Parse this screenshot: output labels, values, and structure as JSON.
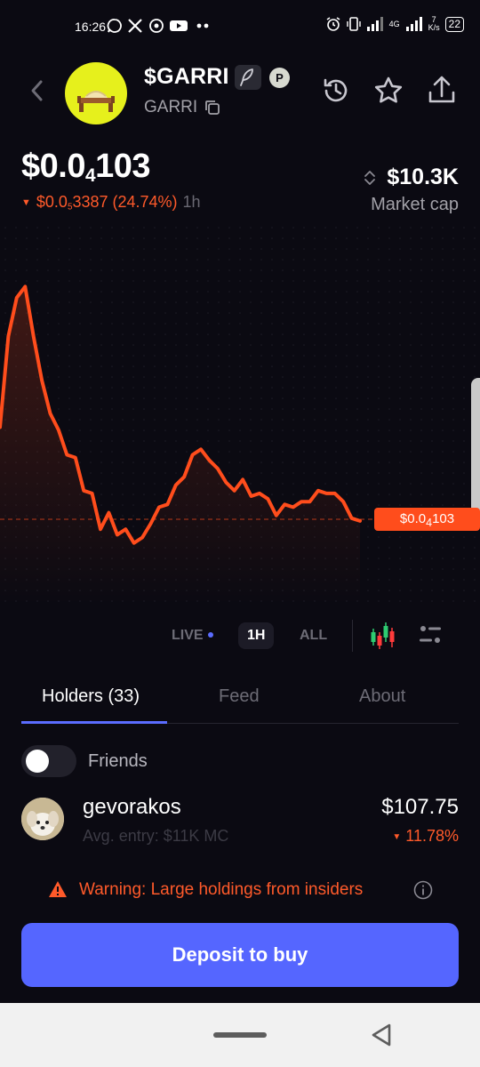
{
  "status_bar": {
    "time": "16:26",
    "network": "4G",
    "speed_top": "7",
    "speed_unit": "K/s",
    "battery": "22"
  },
  "token": {
    "name": "$GARRI",
    "ticker": "GARRI",
    "badge_letter": "P"
  },
  "price": {
    "prefix": "$0.0",
    "zeros_sub": "4",
    "digits": "103",
    "change_prefix": "$0.0",
    "change_sub": "5",
    "change_digits": "3387",
    "change_pct": "(24.74%)",
    "change_direction": "down",
    "timeframe": "1h"
  },
  "market_cap": {
    "value": "$10.3K",
    "label": "Market cap"
  },
  "chart_data": {
    "type": "line",
    "color": "#ff4d1c",
    "current_price_tag": {
      "prefix": "$0.0",
      "sub": "4",
      "digits": "103"
    },
    "y_relative": [
      0.45,
      0.78,
      0.92,
      0.96,
      0.78,
      0.62,
      0.5,
      0.44,
      0.35,
      0.34,
      0.22,
      0.21,
      0.08,
      0.14,
      0.06,
      0.08,
      0.03,
      0.05,
      0.1,
      0.16,
      0.17,
      0.24,
      0.27,
      0.35,
      0.37,
      0.33,
      0.3,
      0.25,
      0.22,
      0.26,
      0.2,
      0.21,
      0.19,
      0.13,
      0.17,
      0.16,
      0.18,
      0.18,
      0.22,
      0.21,
      0.21,
      0.18,
      0.12,
      0.11
    ]
  },
  "range_controls": {
    "live": "LIVE",
    "one_hour": "1H",
    "all": "ALL",
    "active": "1H"
  },
  "tabs": {
    "holders": "Holders (33)",
    "feed": "Feed",
    "about": "About"
  },
  "friends_toggle": {
    "label": "Friends",
    "on": false
  },
  "holders": [
    {
      "name": "gevorakos",
      "avg_entry": "Avg. entry: $11K MC",
      "value": "$107.75",
      "pct": "11.78%",
      "pct_direction": "down"
    }
  ],
  "warning": "Warning: Large holdings from insiders",
  "deposit_button": "Deposit to buy",
  "colors": {
    "background": "#0b0a12",
    "accent": "#5566ff",
    "negative": "#ff5a2a"
  }
}
